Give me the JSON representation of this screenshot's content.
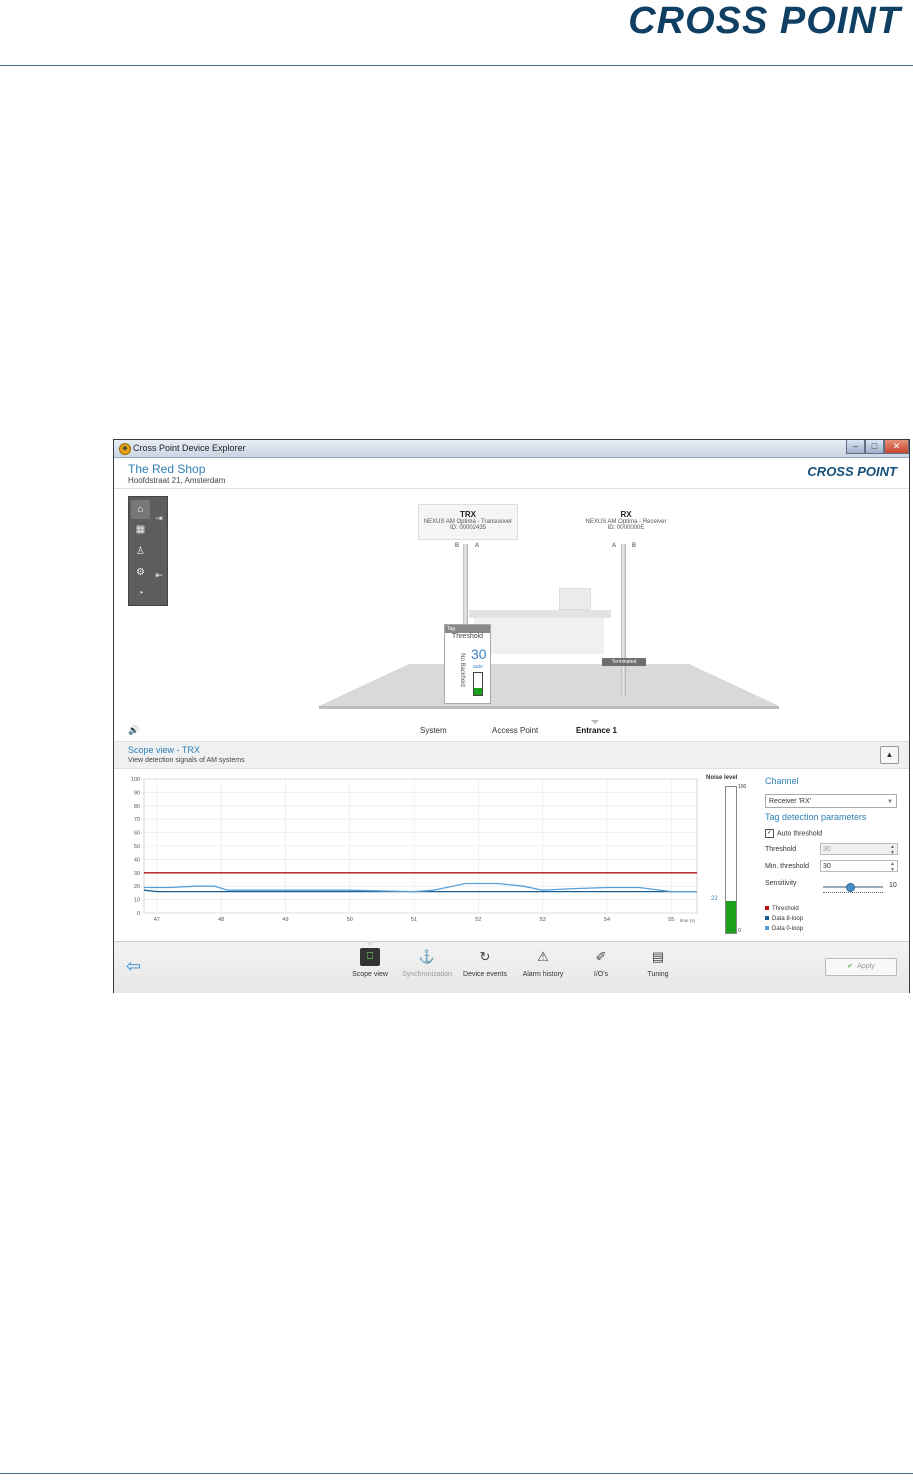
{
  "document": {
    "logo": "CROSS POINT"
  },
  "window": {
    "title": "Cross Point Device Explorer",
    "buttons": {
      "minimize": "–",
      "maximize": "□",
      "close": "✕"
    }
  },
  "header": {
    "shop_name": "The Red Shop",
    "address": "Hoofdstraat 21, Amsterdam",
    "logo": "CROSS POINT"
  },
  "scene": {
    "trx": {
      "title": "TRX",
      "model": "NEXUS AM Optima - Transceiver",
      "id": "ID: 00002435",
      "label_b": "B",
      "label_a": "A"
    },
    "rx": {
      "title": "RX",
      "model": "NEXUS AM Optima - Receiver",
      "id": "ID: 0000000E",
      "label_a": "A",
      "label_b": "B"
    },
    "tag_panel": {
      "header": "Tag",
      "threshold_label": "Threshold",
      "value": "30",
      "auto": "auto",
      "backfield": "No Backfield",
      "level": 0.3
    },
    "terminated": "Terminated"
  },
  "nav": {
    "items": [
      "System",
      "Access Point",
      "Entrance 1"
    ],
    "active_index": 2
  },
  "scope": {
    "title": "Scope view - TRX",
    "subtitle": "View detection signals of AM systems",
    "collapse": "▲"
  },
  "noise": {
    "title": "Noise level",
    "max": "100",
    "min": "0",
    "value": 22,
    "value_label": "22"
  },
  "settings": {
    "channel_heading": "Channel",
    "channel_value": "Receiver 'RX'",
    "params_heading": "Tag detection parameters",
    "auto_threshold_label": "Auto threshold",
    "auto_threshold_checked": true,
    "threshold_label": "Threshold",
    "threshold_value": "30",
    "min_threshold_label": "Min. threshold",
    "min_threshold_value": "30",
    "sensitivity_label": "Sensitivity",
    "sensitivity_value": "10",
    "sensitivity_fraction": 0.45,
    "legend": [
      {
        "label": "Threshold",
        "color": "#b01515"
      },
      {
        "label": "Data 8-loop",
        "color": "#1f5f8f"
      },
      {
        "label": "Data 0-loop",
        "color": "#5aa0d8"
      }
    ]
  },
  "chart_data": {
    "type": "line",
    "xlabel": "time (s)",
    "ylabel": "",
    "xlim": [
      46.8,
      55.4
    ],
    "ylim": [
      0,
      100
    ],
    "x_ticks": [
      "47",
      "48",
      "49",
      "50",
      "51",
      "52",
      "53",
      "54",
      "55"
    ],
    "y_ticks": [
      "0",
      "10",
      "20",
      "30",
      "40",
      "50",
      "60",
      "70",
      "80",
      "90",
      "100"
    ],
    "grid": true,
    "series": [
      {
        "name": "Threshold",
        "color": "#b01515",
        "x": [
          46.8,
          55.4
        ],
        "y": [
          30,
          30
        ]
      },
      {
        "name": "Data 8-loop",
        "color": "#1f5f8f",
        "x": [
          46.8,
          47.0,
          48.0,
          49.0,
          50.0,
          51.0,
          52.0,
          53.0,
          54.0,
          55.0,
          55.4
        ],
        "y": [
          17,
          16,
          16,
          16,
          16,
          16,
          16,
          16,
          16,
          16,
          16
        ]
      },
      {
        "name": "Data 0-loop",
        "color": "#5aa0d8",
        "x": [
          46.8,
          47.2,
          47.6,
          47.9,
          48.1,
          49.0,
          50.0,
          51.0,
          51.3,
          51.8,
          52.3,
          52.7,
          53.0,
          53.4,
          54.0,
          54.5,
          55.0,
          55.4
        ],
        "y": [
          19,
          19,
          20,
          20,
          17,
          17,
          17,
          16,
          17,
          22,
          22,
          20,
          17,
          18,
          19,
          19,
          16,
          16
        ]
      }
    ]
  },
  "toolbar": {
    "tools": [
      {
        "label": "Scope view",
        "icon": "⎕",
        "disabled": false
      },
      {
        "label": "Synchronization",
        "icon": "⚓",
        "disabled": true
      },
      {
        "label": "Device events",
        "icon": "↻",
        "disabled": false
      },
      {
        "label": "Alarm history",
        "icon": "⚠",
        "disabled": false
      },
      {
        "label": "I/O's",
        "icon": "✐",
        "disabled": false
      },
      {
        "label": "Tuning",
        "icon": "▤",
        "disabled": false
      }
    ],
    "apply": "Apply",
    "back": "⇦"
  }
}
